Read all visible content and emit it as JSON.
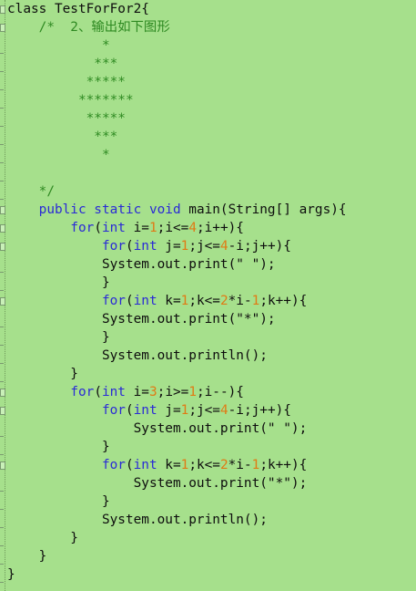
{
  "editor": {
    "background": "#a6e08c",
    "colors": {
      "keyword": "#2a2ad6",
      "number": "#e07a14",
      "comment": "#2f8a22",
      "text": "#0d0d0d"
    },
    "lines": [
      [
        {
          "t": "class TestForFor2{",
          "c": ""
        }
      ],
      [
        {
          "t": "    /*  2、输出如下图形",
          "c": "cm"
        }
      ],
      [
        {
          "t": "            *",
          "c": "cm"
        }
      ],
      [
        {
          "t": "           ***",
          "c": "cm"
        }
      ],
      [
        {
          "t": "          *****",
          "c": "cm"
        }
      ],
      [
        {
          "t": "         *******",
          "c": "cm"
        }
      ],
      [
        {
          "t": "          *****",
          "c": "cm"
        }
      ],
      [
        {
          "t": "           ***",
          "c": "cm"
        }
      ],
      [
        {
          "t": "            *",
          "c": "cm"
        }
      ],
      [],
      [
        {
          "t": "    */",
          "c": "cm"
        }
      ],
      [
        {
          "t": "    public static void ",
          "c": "kw"
        },
        {
          "t": "main(String[] args){",
          "c": ""
        }
      ],
      [
        {
          "t": "        ",
          "c": ""
        },
        {
          "t": "for",
          "c": "kw"
        },
        {
          "t": "(",
          "c": ""
        },
        {
          "t": "int",
          "c": "kw"
        },
        {
          "t": " i=",
          "c": ""
        },
        {
          "t": "1",
          "c": "num"
        },
        {
          "t": ";i<=",
          "c": ""
        },
        {
          "t": "4",
          "c": "num"
        },
        {
          "t": ";i++){",
          "c": ""
        }
      ],
      [
        {
          "t": "            ",
          "c": ""
        },
        {
          "t": "for",
          "c": "kw"
        },
        {
          "t": "(",
          "c": ""
        },
        {
          "t": "int",
          "c": "kw"
        },
        {
          "t": " j=",
          "c": ""
        },
        {
          "t": "1",
          "c": "num"
        },
        {
          "t": ";j<=",
          "c": ""
        },
        {
          "t": "4",
          "c": "num"
        },
        {
          "t": "-i;j++){",
          "c": ""
        }
      ],
      [
        {
          "t": "            System.out.print(\" \");",
          "c": ""
        }
      ],
      [
        {
          "t": "            }",
          "c": ""
        }
      ],
      [
        {
          "t": "            ",
          "c": ""
        },
        {
          "t": "for",
          "c": "kw"
        },
        {
          "t": "(",
          "c": ""
        },
        {
          "t": "int",
          "c": "kw"
        },
        {
          "t": " k=",
          "c": ""
        },
        {
          "t": "1",
          "c": "num"
        },
        {
          "t": ";k<=",
          "c": ""
        },
        {
          "t": "2",
          "c": "num"
        },
        {
          "t": "*i-",
          "c": ""
        },
        {
          "t": "1",
          "c": "num"
        },
        {
          "t": ";k++){",
          "c": ""
        }
      ],
      [
        {
          "t": "            System.out.print(\"*\");",
          "c": ""
        }
      ],
      [
        {
          "t": "            }",
          "c": ""
        }
      ],
      [
        {
          "t": "            System.out.println();",
          "c": ""
        }
      ],
      [
        {
          "t": "        }",
          "c": ""
        }
      ],
      [
        {
          "t": "        ",
          "c": ""
        },
        {
          "t": "for",
          "c": "kw"
        },
        {
          "t": "(",
          "c": ""
        },
        {
          "t": "int",
          "c": "kw"
        },
        {
          "t": " i=",
          "c": ""
        },
        {
          "t": "3",
          "c": "num"
        },
        {
          "t": ";i>=",
          "c": ""
        },
        {
          "t": "1",
          "c": "num"
        },
        {
          "t": ";i--){",
          "c": ""
        }
      ],
      [
        {
          "t": "            ",
          "c": ""
        },
        {
          "t": "for",
          "c": "kw"
        },
        {
          "t": "(",
          "c": ""
        },
        {
          "t": "int",
          "c": "kw"
        },
        {
          "t": " j=",
          "c": ""
        },
        {
          "t": "1",
          "c": "num"
        },
        {
          "t": ";j<=",
          "c": ""
        },
        {
          "t": "4",
          "c": "num"
        },
        {
          "t": "-i;j++){",
          "c": ""
        }
      ],
      [
        {
          "t": "                System.out.print(\" \");",
          "c": ""
        }
      ],
      [
        {
          "t": "            }",
          "c": ""
        }
      ],
      [
        {
          "t": "            ",
          "c": ""
        },
        {
          "t": "for",
          "c": "kw"
        },
        {
          "t": "(",
          "c": ""
        },
        {
          "t": "int",
          "c": "kw"
        },
        {
          "t": " k=",
          "c": ""
        },
        {
          "t": "1",
          "c": "num"
        },
        {
          "t": ";k<=",
          "c": ""
        },
        {
          "t": "2",
          "c": "num"
        },
        {
          "t": "*i-",
          "c": ""
        },
        {
          "t": "1",
          "c": "num"
        },
        {
          "t": ";k++){",
          "c": ""
        }
      ],
      [
        {
          "t": "                System.out.print(\"*\");",
          "c": ""
        }
      ],
      [
        {
          "t": "            }",
          "c": ""
        }
      ],
      [
        {
          "t": "            System.out.println();",
          "c": ""
        }
      ],
      [
        {
          "t": "        }",
          "c": ""
        }
      ],
      [
        {
          "t": "    }",
          "c": ""
        }
      ],
      [
        {
          "t": "}",
          "c": ""
        }
      ]
    ]
  }
}
